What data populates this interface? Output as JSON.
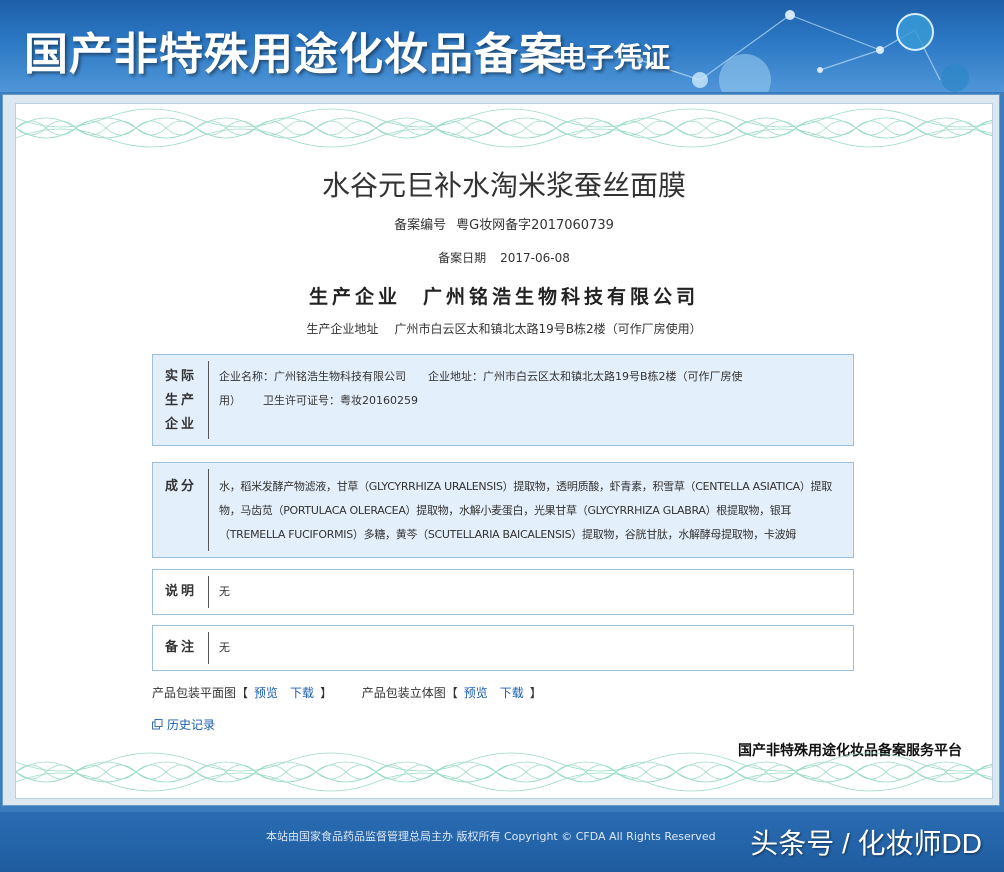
{
  "banner": {
    "title": "国产非特殊用途化妆品备案",
    "subtitle": "电子凭证"
  },
  "certificate": {
    "product_name": "水谷元巨补水淘米浆蚕丝面膜",
    "registration_no": {
      "label": "备案编号",
      "value": "粤G妆网备字2017060739"
    },
    "registration_date": {
      "label": "备案日期",
      "value": "2017-06-08"
    },
    "producer": {
      "label": "生产企业",
      "value": "广州铭浩生物科技有限公司"
    },
    "producer_address": {
      "label": "生产企业地址",
      "value": "广州市白云区太和镇北太路19号B栋2楼（可作厂房使用）"
    },
    "actual_producer": {
      "head": [
        "实际",
        "生产",
        "企业"
      ],
      "company_name": "企业名称：广州铭浩生物科技有限公司",
      "company_address": "企业地址：广州市白云区太和镇北太路19号B栋2楼（可作厂房使",
      "company_address_cont": "用）",
      "license": "卫生许可证号：粤妆20160259"
    },
    "ingredients": {
      "head": "成分",
      "lines": [
        "水，稻米发酵产物滤液，甘草（GLYCYRRHIZA URALENSIS）提取物，透明质酸，虾青素，积雪草（CENTELLA ASIATICA）提取",
        "物，马齿苋（PORTULACA OLERACEA）提取物，水解小麦蛋白，光果甘草（GLYCYRRHIZA GLABRA）根提取物，银耳",
        "（TREMELLA FUCIFORMIS）多糖，黄芩（SCUTELLARIA BAICALENSIS）提取物，谷胱甘肽，水解酵母提取物，卡波姆"
      ]
    },
    "description": {
      "head": "说明",
      "value": "无"
    },
    "remark": {
      "head": "备注",
      "value": "无"
    },
    "packaging": {
      "flat_label": "产品包装平面图",
      "solid_label": "产品包装立体图",
      "bracket_open": "【",
      "bracket_close": "】",
      "preview": "预览",
      "download": "下载"
    },
    "history_label": "历史记录",
    "platform": "国产非特殊用途化妆品备案服务平台"
  },
  "footer": {
    "text": "本站由国家食品药品监督管理总局主办 版权所有 Copyright © CFDA All Rights Reserved",
    "watermark": "头条号 / 化妆师DD"
  }
}
